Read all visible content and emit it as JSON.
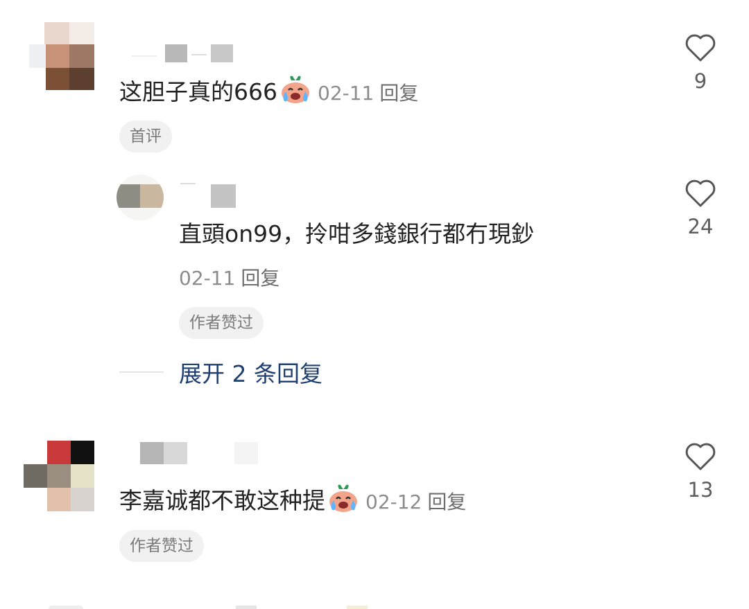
{
  "comments": [
    {
      "text": "这胆子真的666",
      "date": "02-11",
      "reply_label": "回复",
      "tag": "首评",
      "likes": "9",
      "emoji": "crying-face-icon"
    },
    {
      "text": "直頭on99，拎咁多錢銀行都冇現鈔",
      "date": "02-11",
      "reply_label": "回复",
      "tag": "作者赞过",
      "likes": "24"
    },
    {
      "text": "李嘉诚都不敢这种提",
      "date": "02-12",
      "reply_label": "回复",
      "tag": "作者赞过",
      "likes": "13",
      "emoji": "crying-face-icon"
    }
  ],
  "expand": {
    "label": "展开 2 条回复"
  },
  "colors": {
    "link": "#1f3f73",
    "meta": "#8c8c8c",
    "tag_bg": "#f1f1f1"
  }
}
